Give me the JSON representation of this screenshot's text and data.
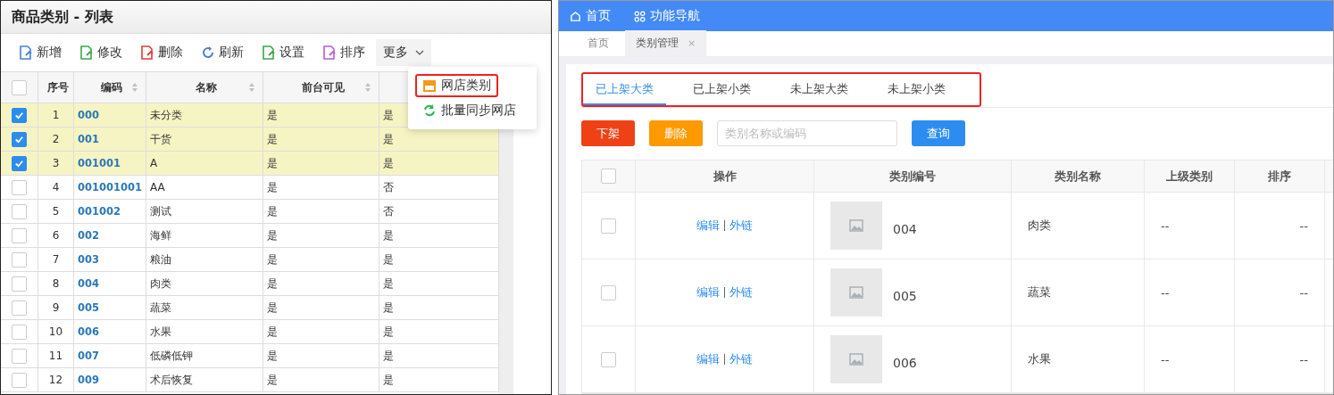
{
  "left": {
    "title": "商品类别 - 列表",
    "toolbar": [
      {
        "label": "新增",
        "kind": "new"
      },
      {
        "label": "修改",
        "kind": "edit"
      },
      {
        "label": "删除",
        "kind": "delete"
      },
      {
        "label": "刷新",
        "kind": "refresh"
      },
      {
        "label": "设置",
        "kind": "settings"
      },
      {
        "label": "排序",
        "kind": "sort"
      }
    ],
    "more_menu": {
      "label": "更多",
      "expanded": true,
      "items": [
        {
          "label": "网店类别",
          "kind": "shop",
          "highlighted": true
        },
        {
          "label": "批量同步网店",
          "kind": "sync",
          "highlighted": false
        }
      ]
    },
    "table": {
      "all_checked": false,
      "columns": [
        {
          "label": "序号",
          "sortable": false
        },
        {
          "label": "编码",
          "sortable": true
        },
        {
          "label": "名称",
          "sortable": true
        },
        {
          "label": "前台可见",
          "sortable": true
        }
      ],
      "rows": [
        {
          "selected": true,
          "index": "1",
          "code": "000",
          "name": "未分类",
          "visible": "是",
          "column_5": "是"
        },
        {
          "selected": true,
          "index": "2",
          "code": "001",
          "name": "干货",
          "visible": "是",
          "column_5": "是"
        },
        {
          "selected": true,
          "index": "3",
          "code": "001001",
          "name": "A",
          "visible": "是",
          "column_5": "是"
        },
        {
          "selected": false,
          "index": "4",
          "code": "001001001",
          "name": "AA",
          "visible": "是",
          "column_5": "否"
        },
        {
          "selected": false,
          "index": "5",
          "code": "001002",
          "name": "测试",
          "visible": "是",
          "column_5": "否"
        },
        {
          "selected": false,
          "index": "6",
          "code": "002",
          "name": "海鲜",
          "visible": "是",
          "column_5": "是"
        },
        {
          "selected": false,
          "index": "7",
          "code": "003",
          "name": "粮油",
          "visible": "是",
          "column_5": "是"
        },
        {
          "selected": false,
          "index": "8",
          "code": "004",
          "name": "肉类",
          "visible": "是",
          "column_5": "是"
        },
        {
          "selected": false,
          "index": "9",
          "code": "005",
          "name": "蔬菜",
          "visible": "是",
          "column_5": "是"
        },
        {
          "selected": false,
          "index": "10",
          "code": "006",
          "name": "水果",
          "visible": "是",
          "column_5": "是"
        },
        {
          "selected": false,
          "index": "11",
          "code": "007",
          "name": "低磷低钾",
          "visible": "是",
          "column_5": "是"
        },
        {
          "selected": false,
          "index": "12",
          "code": "009",
          "name": "术后恢复",
          "visible": "是",
          "column_5": "是"
        }
      ]
    }
  },
  "right": {
    "nav": [
      {
        "label": "首页",
        "kind": "home"
      },
      {
        "label": "功能导航",
        "kind": "apps"
      }
    ],
    "page_tabs": [
      {
        "label": "首页",
        "selected": false,
        "closable": false
      },
      {
        "label": "类别管理",
        "selected": true,
        "closable": true,
        "close": "×"
      }
    ],
    "tabs": {
      "highlighted": true,
      "items": [
        {
          "label": "已上架大类",
          "selected": true
        },
        {
          "label": "已上架小类",
          "selected": false
        },
        {
          "label": "未上架大类",
          "selected": false
        },
        {
          "label": "未上架小类",
          "selected": false
        }
      ]
    },
    "actions": [
      {
        "label": "下架",
        "kind": "danger"
      },
      {
        "label": "删除",
        "kind": "warning"
      }
    ],
    "search": {
      "placeholder": "类别名称或编码"
    },
    "query_button": "查询",
    "table": {
      "all_checked": false,
      "columns": [
        "操作",
        "类别编号",
        "类别名称",
        "上级类别",
        "排序"
      ],
      "rows": [
        {
          "checked": false,
          "actions": [
            "编辑",
            "外链"
          ],
          "code": "004",
          "name": "肉类",
          "parent": "--",
          "sort": "--"
        },
        {
          "checked": false,
          "actions": [
            "编辑",
            "外链"
          ],
          "code": "005",
          "name": "蔬菜",
          "parent": "--",
          "sort": "--"
        },
        {
          "checked": false,
          "actions": [
            "编辑",
            "外链"
          ],
          "code": "006",
          "name": "水果",
          "parent": "--",
          "sort": "--"
        }
      ]
    }
  }
}
